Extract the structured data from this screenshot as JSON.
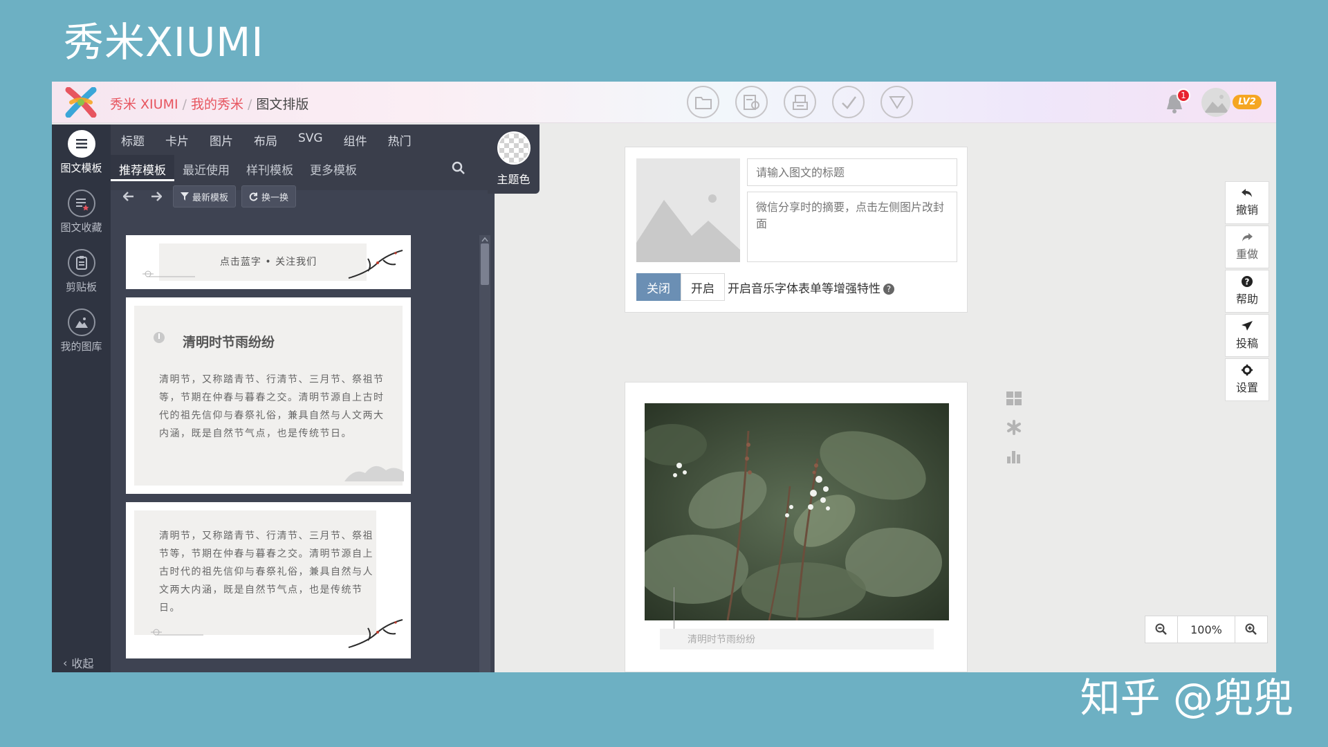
{
  "slide": {
    "title": "秀米XIUMI",
    "watermark": "知乎 @兜兜"
  },
  "header": {
    "crumbs": [
      "秀米 XIUMI",
      "我的秀米",
      "图文排版"
    ],
    "crumb_sep": "/",
    "notification_count": "1",
    "level": "LV2"
  },
  "rail": {
    "items": [
      {
        "label": "图文模板"
      },
      {
        "label": "图文收藏"
      },
      {
        "label": "剪贴板"
      },
      {
        "label": "我的图库"
      }
    ],
    "collapse_label": "收起"
  },
  "panel": {
    "categories": [
      "标题",
      "卡片",
      "图片",
      "布局",
      "SVG",
      "组件",
      "热门"
    ],
    "subtabs": [
      "推荐模板",
      "最近使用",
      "样刊模板",
      "更多模板"
    ],
    "theme_label": "主题色",
    "toolbar": {
      "latest": "最新模板",
      "swap": "换一换"
    },
    "templates": {
      "t1_text": "点击蓝字 • 关注我们",
      "t2_title": "清明时节雨纷纷",
      "t2_body": "清明节，又称踏青节、行清节、三月节、祭祖节等，节期在仲春与暮春之交。清明节源自上古时代的祖先信仰与春祭礼俗，兼具自然与人文两大内涵，既是自然节气点，也是传统节日。",
      "t3_body": "清明节，又称踏青节、行清节、三月节、祭祖节等，节期在仲春与暮春之交。清明节源自上古时代的祖先信仰与春祭礼俗，兼具自然与人文两大内涵，既是自然节气点，也是传统节日。"
    }
  },
  "info_card": {
    "title_placeholder": "请输入图文的标题",
    "summary_placeholder": "微信分享时的摘要，点击左侧图片改封面",
    "toggle_off": "关闭",
    "toggle_on": "开启",
    "music_label": "开启音乐字体表单等增强特性",
    "help": "?"
  },
  "editor": {
    "caption": "清明时节雨纷纷"
  },
  "actions": [
    "撤销",
    "重做",
    "帮助",
    "投稿",
    "设置"
  ],
  "zoom": {
    "value": "100%"
  },
  "colors": {
    "background": "#6db0c3",
    "rail": "#2f3441",
    "accent": "#e7555f",
    "toggle_active": "#6b8fb4"
  }
}
